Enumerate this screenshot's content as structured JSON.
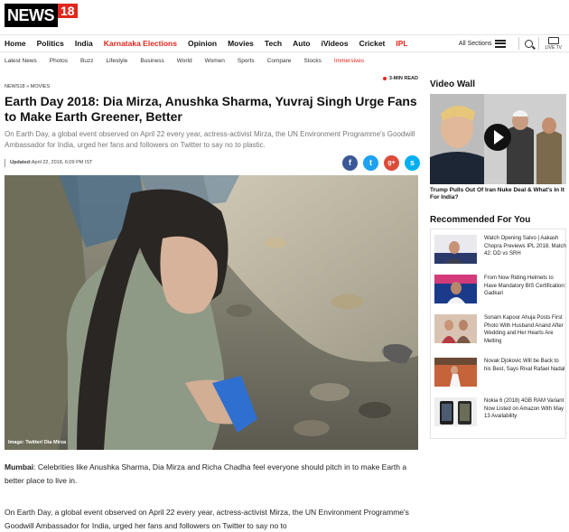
{
  "logo": {
    "text": "NEWS",
    "number": "18"
  },
  "main_nav": {
    "items": [
      "Home",
      "Politics",
      "India",
      "Karnataka Elections",
      "Opinion",
      "Movies",
      "Tech",
      "Auto",
      "iVideos",
      "Cricket",
      "IPL"
    ],
    "all_sections_label": "All Sections",
    "live_tv_label": "LIVE TV"
  },
  "sub_nav": {
    "items": [
      "Latest News",
      "Photos",
      "Buzz",
      "Lifestyle",
      "Business",
      "World",
      "Women",
      "Sports",
      "Compare",
      "Stocks",
      "Immersives"
    ]
  },
  "article": {
    "breadcrumb": "NEWS18 » MOVIES",
    "read_time": "3-MIN READ",
    "title": "Earth Day 2018: Dia Mirza, Anushka Sharma, Yuvraj Singh Urge Fans to Make Earth Greener, Better",
    "lede": "On Earth Day, a global event observed on April 22 every year, actress-activist Mirza, the UN Environment Programme's Goodwill Ambassador for India, urged her fans and followers on Twitter to say no to plastic.",
    "updated_label": "Updated:",
    "updated_value": "April 22, 2018, 6:09 PM IST",
    "image_caption": "Image: Twitter/ Dia Mirza",
    "p1_lead": "Mumbai",
    "p1_rest": ": Celebrities like Anushka Sharma, Dia Mirza and Richa Chadha feel everyone should pitch in to make Earth a better place to live in.",
    "p2": "On Earth Day, a global event observed on April 22 every year, actress-activist Mirza, the UN Environment Programme's Goodwill Ambassador for India, urged her fans and followers on Twitter to say no to"
  },
  "social": {
    "facebook": "f",
    "twitter": "t",
    "google": "g+",
    "skype": "s"
  },
  "colors": {
    "accent": "#e1261c",
    "facebook": "#3b5998",
    "twitter": "#1da1f2",
    "google": "#dd4b39",
    "skype": "#00aff0"
  },
  "sidebar": {
    "video_wall_title": "Video Wall",
    "video_caption": "Trump Pulls Out Of Iran Nuke Deal & What's In It For India?",
    "recommended_title": "Recommended For You",
    "recommended": [
      {
        "text": "Watch Opening Salvo | Aakash Chopra Previews IPL 2018, Match 42: DD vs SRH"
      },
      {
        "text": "From Now Riding Helmets to Have Mandatory BIS Certification: Gadkari"
      },
      {
        "text": "Sonam Kapoor Ahuja Posts First Photo With Husband Anand After Wedding and Her Hearts Are Melting"
      },
      {
        "text": "Novak Djokovic Will be Back to his Best, Says Rival Rafael Nadal"
      },
      {
        "text": "Nokia 6 (2018) 4GB RAM Variant Now Listed on Amazon With May 13 Availability"
      }
    ]
  }
}
